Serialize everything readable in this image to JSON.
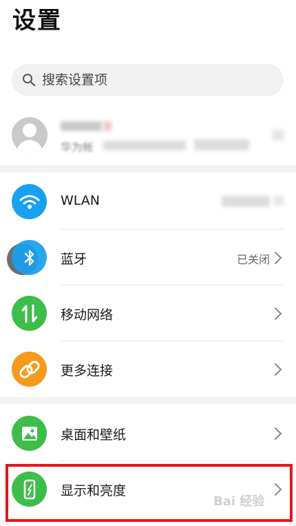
{
  "page": {
    "title": "设置"
  },
  "search": {
    "placeholder": "搜索设置项"
  },
  "account": {
    "sub_text": "华为帐"
  },
  "settings": [
    {
      "id": "wlan",
      "label": "WLAN",
      "value": "",
      "icon": "wifi-icon",
      "color": "#1aa0f0"
    },
    {
      "id": "bluetooth",
      "label": "蓝牙",
      "value": "已关闭",
      "icon": "bluetooth-icon",
      "color": "#1aa0f0"
    },
    {
      "id": "mobile-network",
      "label": "移动网络",
      "value": "",
      "icon": "mobile-data-icon",
      "color": "#3dbd4a"
    },
    {
      "id": "more-connections",
      "label": "更多连接",
      "value": "",
      "icon": "link-icon",
      "color": "#f59a1b"
    },
    {
      "id": "home-wallpaper",
      "label": "桌面和壁纸",
      "value": "",
      "icon": "picture-icon",
      "color": "#3dbd4a"
    },
    {
      "id": "display-brightness",
      "label": "显示和亮度",
      "value": "",
      "icon": "phone-display-icon",
      "color": "#3dbd4a"
    }
  ],
  "watermark": {
    "text": "Bai 经验"
  }
}
